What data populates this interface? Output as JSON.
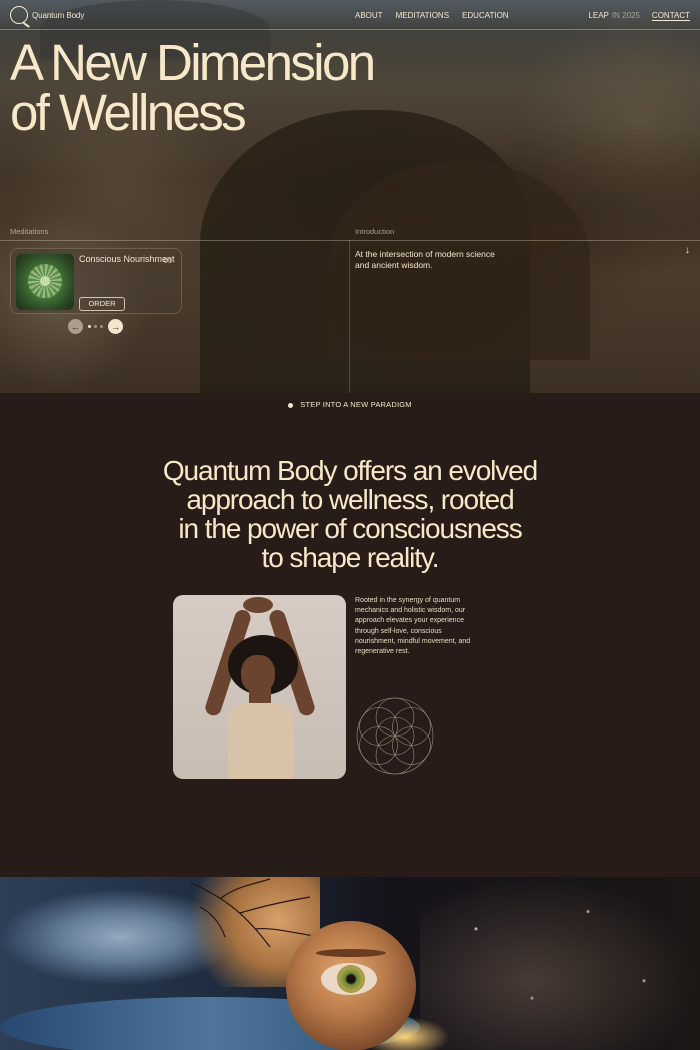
{
  "brand": {
    "name": "Quantum Body"
  },
  "nav": {
    "links": [
      "ABOUT",
      "MEDITATIONS",
      "EDUCATION"
    ],
    "leap_label": "LEAP",
    "leap_sub": "IN 2025",
    "contact": "CONTACT"
  },
  "hero": {
    "headline_line1": "A New Dimension",
    "headline_line2": "of Wellness",
    "meditations_label": "Meditations",
    "introduction_label": "Introduction",
    "introduction_text": "At the intersection of modern science and ancient wisdom.",
    "card": {
      "title": "Conscious Nourishment",
      "number": "01",
      "button": "ORDER"
    }
  },
  "carousel": {
    "total_dots": 3,
    "active_dot": 1
  },
  "section": {
    "eyebrow": "STEP INTO A NEW PARADIGM",
    "statement_l1": "Quantum Body offers an evolved",
    "statement_l2": "approach to wellness, rooted",
    "statement_l3": "in the power of consciousness",
    "statement_l4": "to shape reality.",
    "body": "Rooted in the synergy of quantum mechanics and holistic wisdom, our approach elevates your experience through self-love, conscious nourishment, mindful movement, and regenerative rest."
  },
  "colors": {
    "cream": "#f3e7cf",
    "dark_bg": "#271c17"
  }
}
